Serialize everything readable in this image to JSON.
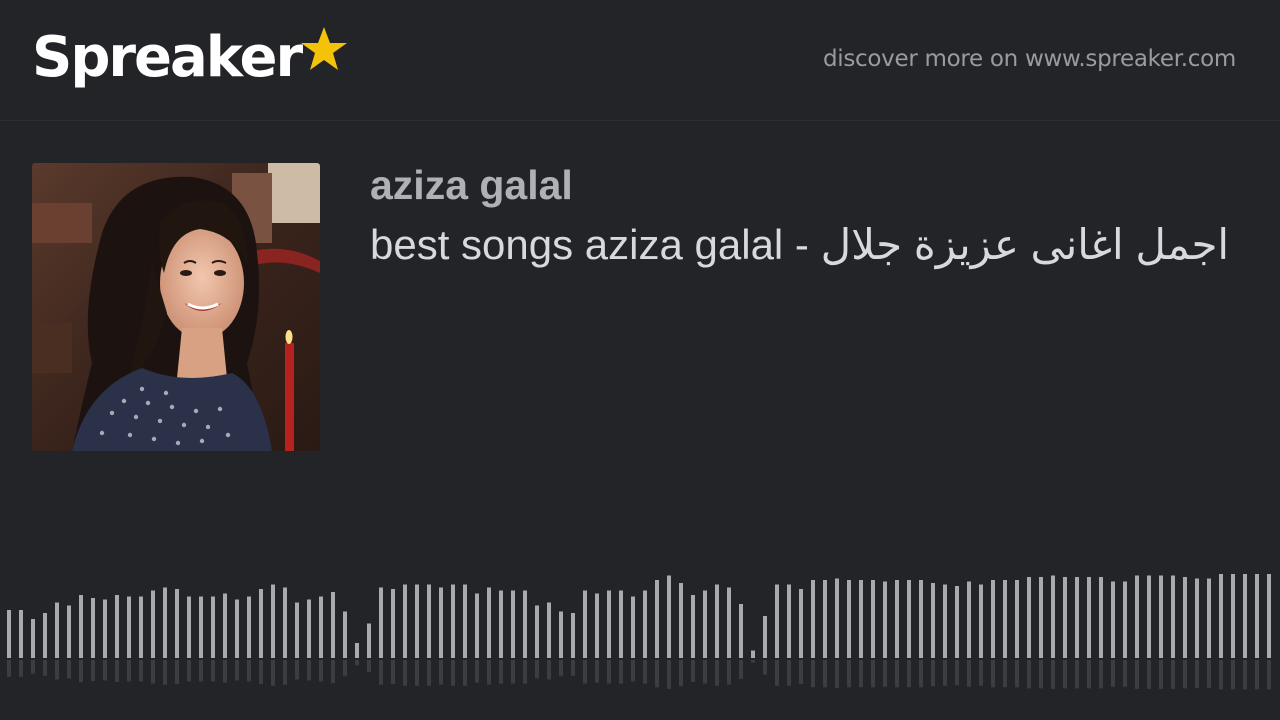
{
  "header": {
    "logo_text": "Spreaker",
    "logo_icon": "star-icon",
    "discover_text": "discover more on www.spreaker.com"
  },
  "episode": {
    "show_name": "aziza galal",
    "title": "best songs aziza galal - اجمل اغانى عزيزة جلال"
  },
  "cover": {
    "description_icon": "cover-art-image"
  },
  "colors": {
    "background": "#232428",
    "accent_star": "#f5c20a",
    "wave_top": "#a9aaae",
    "wave_bottom": "#3c3d42",
    "played": "#ffffff"
  },
  "player": {
    "progress": 0.0,
    "waveform_levels": [
      0.32,
      0.32,
      0.26,
      0.3,
      0.37,
      0.35,
      0.42,
      0.4,
      0.39,
      0.42,
      0.41,
      0.41,
      0.45,
      0.47,
      0.46,
      0.41,
      0.41,
      0.41,
      0.43,
      0.39,
      0.41,
      0.46,
      0.49,
      0.47,
      0.37,
      0.39,
      0.41,
      0.44,
      0.31,
      0.1,
      0.23,
      0.47,
      0.46,
      0.49,
      0.49,
      0.49,
      0.47,
      0.49,
      0.49,
      0.43,
      0.47,
      0.45,
      0.45,
      0.45,
      0.35,
      0.37,
      0.31,
      0.3,
      0.45,
      0.43,
      0.45,
      0.45,
      0.41,
      0.45,
      0.52,
      0.55,
      0.5,
      0.42,
      0.45,
      0.49,
      0.47,
      0.36,
      0.05,
      0.28,
      0.49,
      0.49,
      0.46,
      0.52,
      0.52,
      0.53,
      0.52,
      0.52,
      0.52,
      0.51,
      0.52,
      0.52,
      0.52,
      0.5,
      0.49,
      0.48,
      0.51,
      0.49,
      0.52,
      0.52,
      0.52,
      0.54,
      0.54,
      0.55,
      0.54,
      0.54,
      0.54,
      0.54,
      0.51,
      0.51,
      0.55,
      0.55,
      0.55,
      0.55,
      0.54,
      0.53,
      0.53,
      0.56,
      0.56,
      0.56,
      0.56,
      0.56
    ]
  }
}
